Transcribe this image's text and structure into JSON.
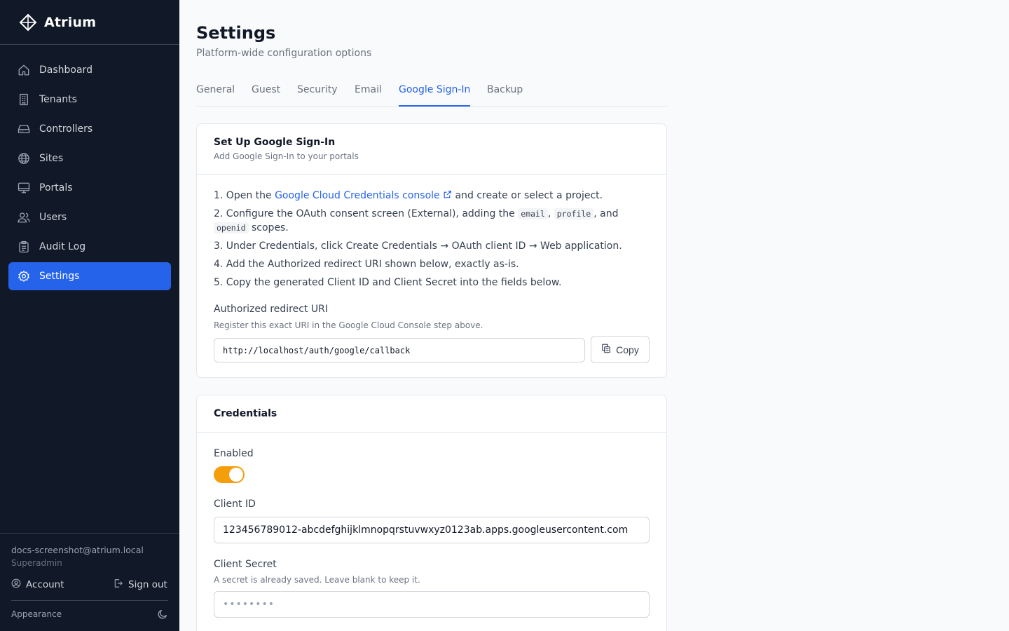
{
  "app": {
    "name": "Atrium"
  },
  "sidebar": {
    "items": [
      {
        "label": "Dashboard",
        "icon": "home-icon"
      },
      {
        "label": "Tenants",
        "icon": "building-icon"
      },
      {
        "label": "Controllers",
        "icon": "hard-drive-icon"
      },
      {
        "label": "Sites",
        "icon": "globe-icon"
      },
      {
        "label": "Portals",
        "icon": "monitor-icon"
      },
      {
        "label": "Users",
        "icon": "users-icon"
      },
      {
        "label": "Audit Log",
        "icon": "clipboard-icon"
      },
      {
        "label": "Settings",
        "icon": "gear-icon",
        "active": true
      }
    ],
    "user": {
      "email": "docs-screenshot@atrium.local",
      "role": "Superadmin"
    },
    "account_label": "Account",
    "signout_label": "Sign out",
    "appearance_label": "Appearance"
  },
  "page": {
    "title": "Settings",
    "subtitle": "Platform-wide configuration options"
  },
  "tabs": [
    {
      "label": "General"
    },
    {
      "label": "Guest"
    },
    {
      "label": "Security"
    },
    {
      "label": "Email"
    },
    {
      "label": "Google Sign-In",
      "active": true
    },
    {
      "label": "Backup"
    }
  ],
  "setup": {
    "title": "Set Up Google Sign-In",
    "description": "Add Google Sign-In to your portals",
    "step1_prefix": "1. Open the ",
    "step1_link": "Google Cloud Credentials console",
    "step1_suffix": " and create or select a project.",
    "step2_prefix": "2. Configure the OAuth consent screen (External), adding the ",
    "step2_code1": "email",
    "step2_sep": ", ",
    "step2_code2": "profile",
    "step2_and": ", and ",
    "step2_code3": "openid",
    "step2_suffix": " scopes.",
    "step3": "3. Under Credentials, click Create Credentials → OAuth client ID → Web application.",
    "step4": "4. Add the Authorized redirect URI shown below, exactly as-is.",
    "step5": "5. Copy the generated Client ID and Client Secret into the fields below.",
    "redirect_label": "Authorized redirect URI",
    "redirect_help": "Register this exact URI in the Google Cloud Console step above.",
    "redirect_uri": "http://localhost/auth/google/callback",
    "copy_label": "Copy"
  },
  "credentials": {
    "title": "Credentials",
    "enabled_label": "Enabled",
    "enabled": true,
    "client_id_label": "Client ID",
    "client_id": "123456789012-abcdefghijklmnopqrstuvwxyz0123ab.apps.googleusercontent.com",
    "client_secret_label": "Client Secret",
    "client_secret_help": "A secret is already saved. Leave blank to keep it.",
    "client_secret_placeholder": "••••••••"
  },
  "colors": {
    "accent": "#2563eb",
    "sidebar_bg": "#111827",
    "toggle_on": "#f59e0b"
  }
}
